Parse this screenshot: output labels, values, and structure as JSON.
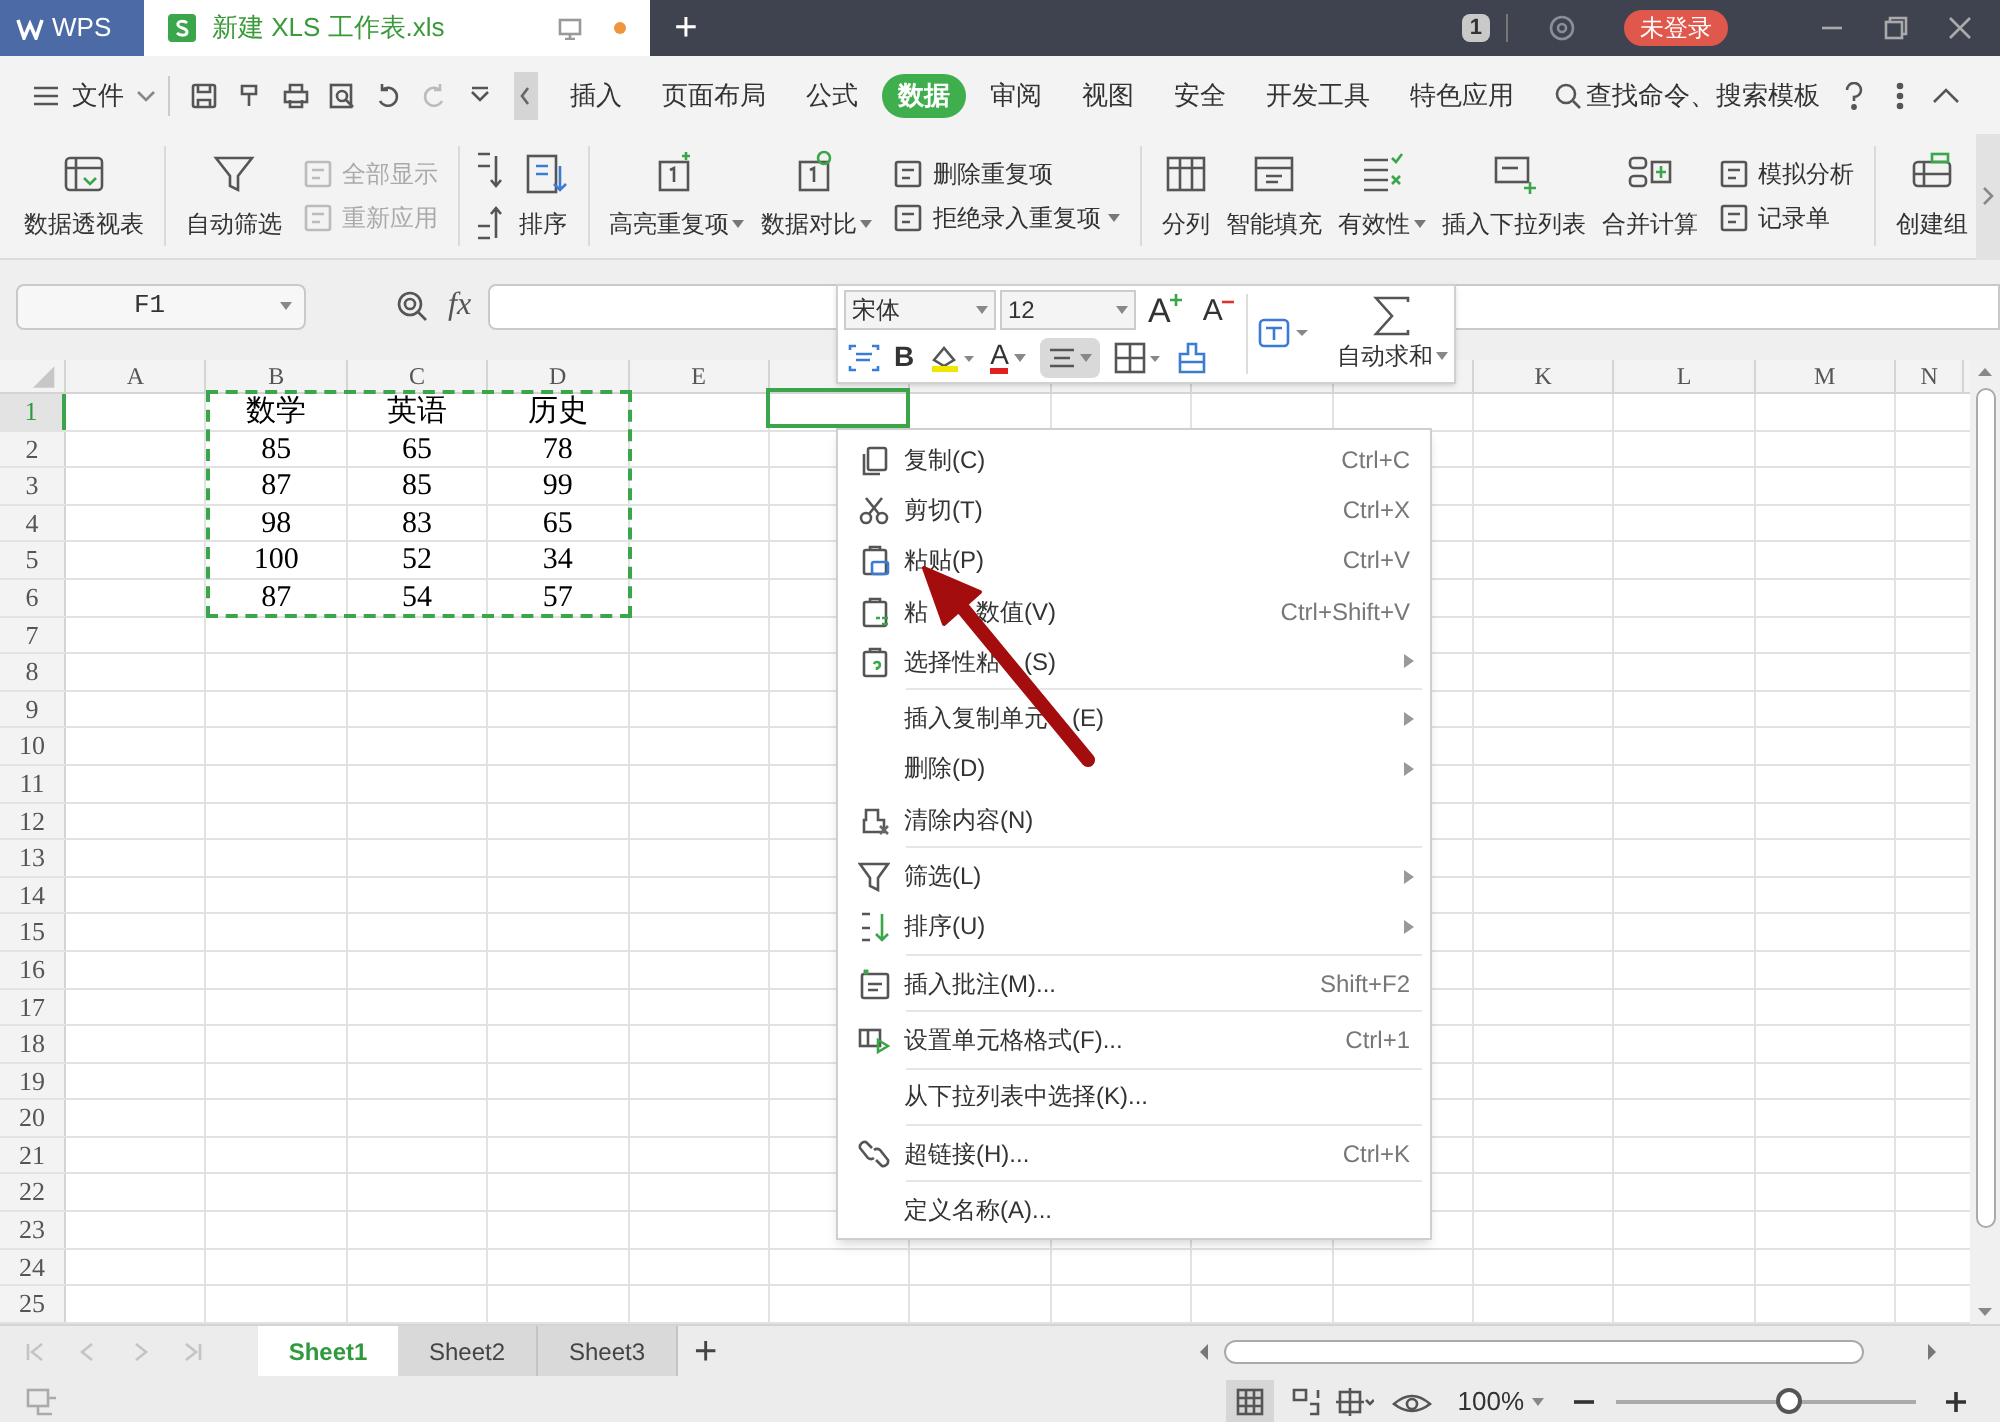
{
  "title_bar": {
    "app": "WPS",
    "document": "新建 XLS 工作表.xls",
    "new_tab": "+",
    "badge": "1",
    "login": "未登录"
  },
  "menu_bar": {
    "file": "文件",
    "tabs": [
      {
        "label": "插入",
        "selected": false
      },
      {
        "label": "页面布局",
        "selected": false
      },
      {
        "label": "公式",
        "selected": false
      },
      {
        "label": "数据",
        "selected": true
      },
      {
        "label": "审阅",
        "selected": false
      },
      {
        "label": "视图",
        "selected": false
      },
      {
        "label": "安全",
        "selected": false
      },
      {
        "label": "开发工具",
        "selected": false
      },
      {
        "label": "特色应用",
        "selected": false
      }
    ],
    "search": "查找命令、搜索模板"
  },
  "ribbon": {
    "groups": [
      {
        "items": [
          {
            "label": "数据透视表",
            "kind": "large",
            "disabled": false,
            "dropdown": false
          }
        ]
      },
      {
        "items": [
          {
            "label": "自动筛选",
            "kind": "large",
            "disabled": false,
            "dropdown": false
          },
          {
            "label": "全部显示",
            "kind": "small",
            "disabled": true,
            "dropdown": false
          },
          {
            "label": "重新应用",
            "kind": "small",
            "disabled": true,
            "dropdown": false
          }
        ]
      },
      {
        "items": [
          {
            "label": "排序",
            "kind": "large",
            "disabled": false,
            "dropdown": false
          }
        ]
      },
      {
        "items": [
          {
            "label": "高亮重复项",
            "kind": "large",
            "disabled": false,
            "dropdown": true
          },
          {
            "label": "数据对比",
            "kind": "large",
            "disabled": false,
            "dropdown": true
          },
          {
            "label": "删除重复项",
            "kind": "small",
            "disabled": false,
            "dropdown": false
          },
          {
            "label": "拒绝录入重复项",
            "kind": "small",
            "disabled": false,
            "dropdown": true
          }
        ]
      },
      {
        "items": [
          {
            "label": "分列",
            "kind": "large",
            "disabled": false,
            "dropdown": false
          },
          {
            "label": "智能填充",
            "kind": "large",
            "disabled": false,
            "dropdown": false
          },
          {
            "label": "有效性",
            "kind": "large",
            "disabled": false,
            "dropdown": true
          },
          {
            "label": "插入下拉列表",
            "kind": "large",
            "disabled": false,
            "dropdown": false
          },
          {
            "label": "合并计算",
            "kind": "large",
            "disabled": false,
            "dropdown": false
          },
          {
            "label": "模拟分析",
            "kind": "small",
            "disabled": false,
            "dropdown": false
          },
          {
            "label": "记录单",
            "kind": "small",
            "disabled": false,
            "dropdown": false
          }
        ]
      },
      {
        "items": [
          {
            "label": "创建组",
            "kind": "large",
            "disabled": false,
            "dropdown": false
          }
        ]
      }
    ]
  },
  "formula_bar": {
    "name_box": "F1",
    "fx": "fx"
  },
  "sheet": {
    "columns_left": [
      "A",
      "B",
      "C",
      "D",
      "E"
    ],
    "columns_right": [
      "K",
      "L",
      "M",
      "N"
    ],
    "copy_marquee": true,
    "rows": [
      {
        "number": "1",
        "selected": true,
        "cells": [
          "数学",
          "英语",
          "历史"
        ]
      },
      {
        "number": "2",
        "selected": false,
        "cells": [
          "85",
          "65",
          "78"
        ]
      },
      {
        "number": "3",
        "selected": false,
        "cells": [
          "87",
          "85",
          "99"
        ]
      },
      {
        "number": "4",
        "selected": false,
        "cells": [
          "98",
          "83",
          "65"
        ]
      },
      {
        "number": "5",
        "selected": false,
        "cells": [
          "100",
          "52",
          "34"
        ]
      },
      {
        "number": "6",
        "selected": false,
        "cells": [
          "87",
          "54",
          "57"
        ]
      },
      {
        "number": "7",
        "selected": false
      },
      {
        "number": "8",
        "selected": false
      },
      {
        "number": "9",
        "selected": false
      },
      {
        "number": "10",
        "selected": false
      },
      {
        "number": "11",
        "selected": false
      },
      {
        "number": "12",
        "selected": false
      },
      {
        "number": "13",
        "selected": false
      },
      {
        "number": "14",
        "selected": false
      },
      {
        "number": "15",
        "selected": false
      },
      {
        "number": "16",
        "selected": false
      },
      {
        "number": "17",
        "selected": false
      },
      {
        "number": "18",
        "selected": false
      },
      {
        "number": "19",
        "selected": false
      },
      {
        "number": "20",
        "selected": false
      },
      {
        "number": "21",
        "selected": false
      },
      {
        "number": "22",
        "selected": false
      },
      {
        "number": "23",
        "selected": false
      },
      {
        "number": "24",
        "selected": false
      },
      {
        "number": "25",
        "selected": false
      }
    ]
  },
  "mini_toolbar": {
    "font": "宋体",
    "size": "12",
    "grow": "A",
    "shrink": "A",
    "bold": "B",
    "font_color": "A",
    "sum": "自动求和",
    "align_pressed": true
  },
  "context_menu": [
    {
      "label": "复制(C)",
      "shortcut": "Ctrl+C",
      "submenu": false,
      "separator_before": false
    },
    {
      "label": "剪切(T)",
      "shortcut": "Ctrl+X",
      "submenu": false,
      "separator_before": false
    },
    {
      "label": "粘贴(P)",
      "shortcut": "Ctrl+V",
      "submenu": false,
      "separator_before": false
    },
    {
      "label_parts": [
        "粘",
        "数值(V)"
      ],
      "shortcut": "Ctrl+Shift+V",
      "submenu": false,
      "separator_before": false
    },
    {
      "label_parts": [
        "选择性粘",
        "(S)"
      ],
      "submenu": true,
      "separator_before": false
    },
    {
      "label_parts": [
        "插入复制单元",
        "(E)"
      ],
      "submenu": true,
      "separator_before": true
    },
    {
      "label": "删除(D)",
      "submenu": true,
      "separator_before": false
    },
    {
      "label": "清除内容(N)",
      "submenu": false,
      "separator_before": false
    },
    {
      "label": "筛选(L)",
      "submenu": true,
      "separator_before": true
    },
    {
      "label": "排序(U)",
      "submenu": true,
      "separator_before": false
    },
    {
      "label": "插入批注(M)...",
      "shortcut": "Shift+F2",
      "submenu": false,
      "separator_before": true
    },
    {
      "label": "设置单元格格式(F)...",
      "shortcut": "Ctrl+1",
      "submenu": false,
      "separator_before": true
    },
    {
      "label": "从下拉列表中选择(K)...",
      "submenu": false,
      "separator_before": true
    },
    {
      "label": "超链接(H)...",
      "shortcut": "Ctrl+K",
      "submenu": false,
      "separator_before": true
    },
    {
      "label": "定义名称(A)...",
      "submenu": false,
      "separator_before": true
    }
  ],
  "sheet_tabs": [
    {
      "label": "Sheet1",
      "selected": true
    },
    {
      "label": "Sheet2",
      "selected": false
    },
    {
      "label": "Sheet3",
      "selected": false
    }
  ],
  "add_sheet": "+",
  "status_bar": {
    "zoom": "100%",
    "zoom_slider": {
      "level": 0.57
    }
  }
}
